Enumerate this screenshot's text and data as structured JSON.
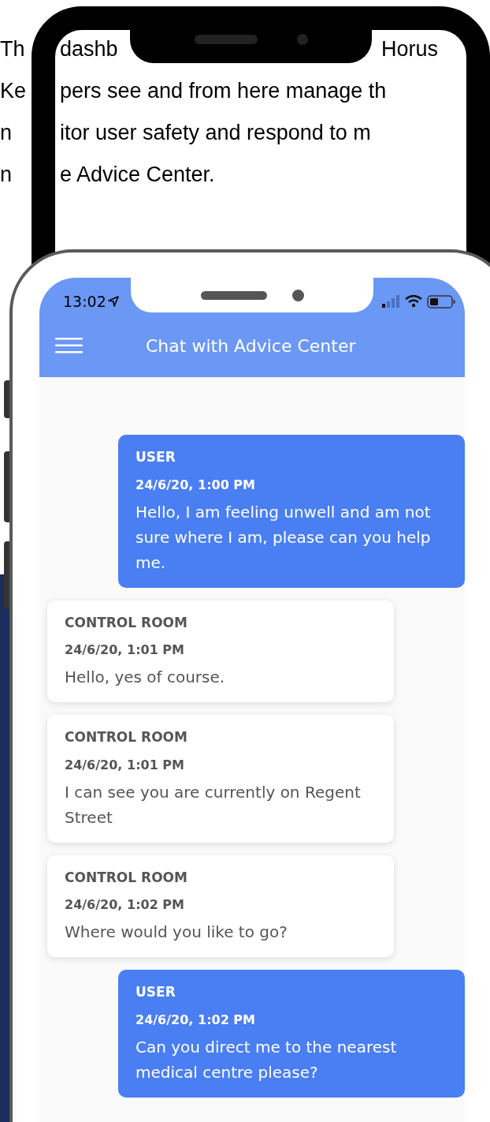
{
  "background_text": {
    "lines": [
      {
        "left": "Th",
        "segments": [
          "dashb",
          "Horus"
        ]
      },
      {
        "left": "Ke",
        "segments": [
          "pers see and from here manage th"
        ]
      },
      {
        "left": "n",
        "segments": [
          "itor user safety and respond to m"
        ]
      },
      {
        "left": "n",
        "segments": [
          "e Advice Center."
        ]
      }
    ]
  },
  "phone": {
    "status_bar": {
      "time": "13:02"
    },
    "header": {
      "title": "Chat with Advice Center"
    },
    "messages": [
      {
        "kind": "user",
        "sender": "USER",
        "time": "24/6/20, 1:00 PM",
        "text": "Hello, I am feeling unwell and am not sure where I am, please can you help me."
      },
      {
        "kind": "control",
        "sender": "CONTROL ROOM",
        "time": "24/6/20, 1:01 PM",
        "text": "Hello, yes of course."
      },
      {
        "kind": "control",
        "sender": "CONTROL ROOM",
        "time": "24/6/20, 1:01 PM",
        "text": "I can see you are currently on Regent Street"
      },
      {
        "kind": "control",
        "sender": "CONTROL ROOM",
        "time": "24/6/20, 1:02 PM",
        "text": "Where would you like to go?"
      },
      {
        "kind": "user",
        "sender": "USER",
        "time": "24/6/20, 1:02 PM",
        "text": "Can you direct me to the nearest medical centre please?"
      }
    ]
  }
}
